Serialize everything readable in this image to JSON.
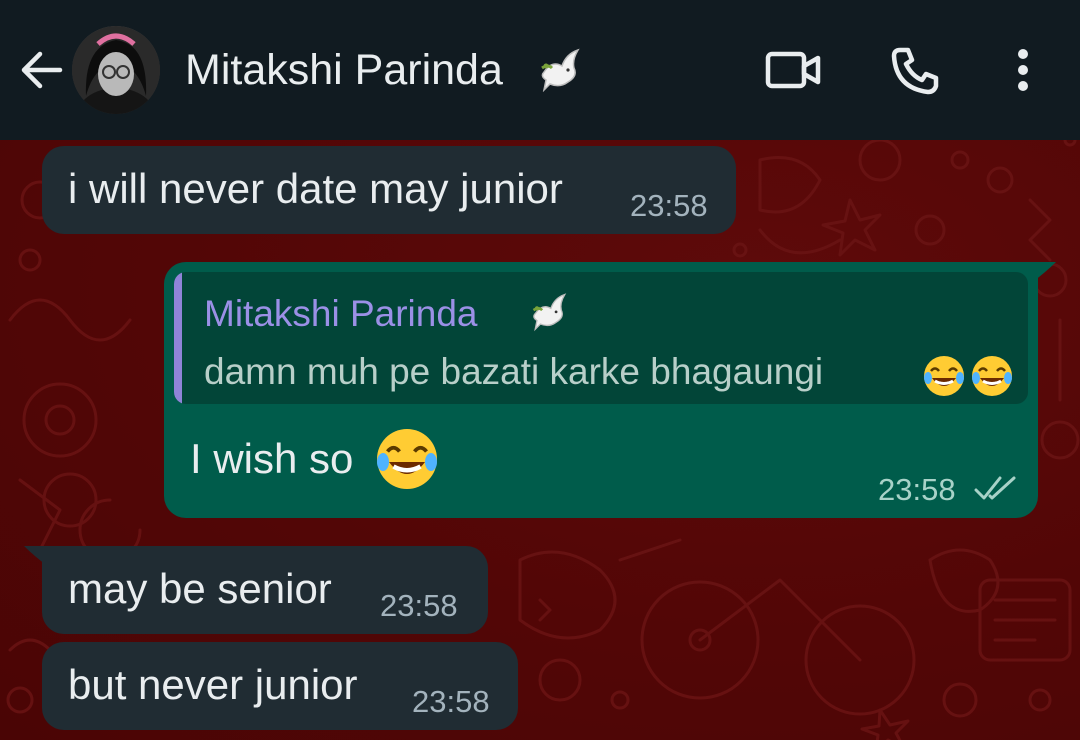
{
  "header": {
    "back_icon": "arrow-left-icon",
    "contact_name": "Mitakshi Parinda",
    "name_emoji": "dove-icon",
    "video_icon": "video-call-icon",
    "call_icon": "phone-icon",
    "menu_icon": "more-vertical-icon",
    "bg_color": "#111b21"
  },
  "chat": {
    "wallpaper_color": "#520606",
    "incoming_bubble_color": "#202c33",
    "outgoing_bubble_color": "#005c4b",
    "messages": [
      {
        "direction": "incoming",
        "text": "i will never date may junior",
        "time": "23:58"
      },
      {
        "direction": "outgoing",
        "reply_to": {
          "name": "Mitakshi Parinda",
          "name_emoji": "dove-icon",
          "text": "damn muh pe bazati karke bhagaungi",
          "emojis": [
            "laughing-tears-emoji",
            "laughing-tears-emoji"
          ]
        },
        "text": "I wish so",
        "emoji": "laughing-tears-emoji",
        "time": "23:58",
        "status": "double-check-icon"
      },
      {
        "direction": "incoming",
        "text": "may be senior",
        "time": "23:58"
      },
      {
        "direction": "incoming",
        "text": "but never junior",
        "time": "23:58"
      }
    ]
  }
}
